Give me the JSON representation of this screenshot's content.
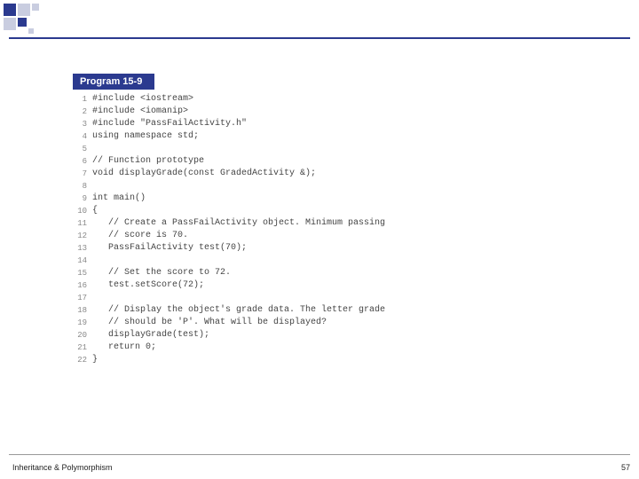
{
  "program": {
    "title": "Program 15-9",
    "lines": [
      "#include <iostream>",
      "#include <iomanip>",
      "#include \"PassFailActivity.h\"",
      "using namespace std;",
      "",
      "// Function prototype",
      "void displayGrade(const GradedActivity &);",
      "",
      "int main()",
      "{",
      "   // Create a PassFailActivity object. Minimum passing",
      "   // score is 70.",
      "   PassFailActivity test(70);",
      "",
      "   // Set the score to 72.",
      "   test.setScore(72);",
      "",
      "   // Display the object's grade data. The letter grade",
      "   // should be 'P'. What will be displayed?",
      "   displayGrade(test);",
      "   return 0;",
      "}"
    ]
  },
  "footer": {
    "text": "Inheritance & Polymorphism",
    "page": "57"
  }
}
